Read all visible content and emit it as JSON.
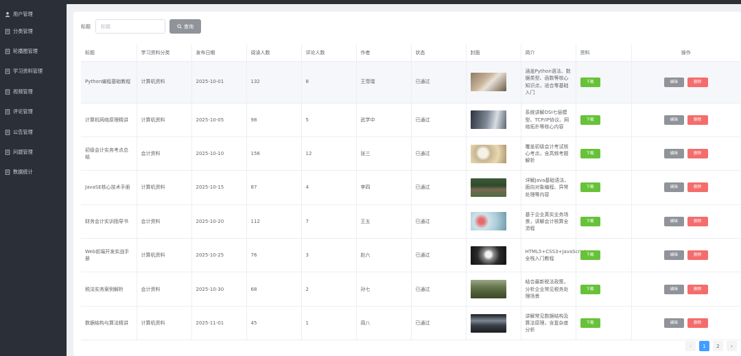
{
  "sidebar": {
    "items": [
      {
        "label": "用户管理",
        "icon": "user-icon"
      },
      {
        "label": "分类管理",
        "icon": "document-icon"
      },
      {
        "label": "轮播图管理",
        "icon": "document-icon"
      },
      {
        "label": "学习资料管理",
        "icon": "document-icon"
      },
      {
        "label": "视频管理",
        "icon": "document-icon"
      },
      {
        "label": "评论管理",
        "icon": "document-icon"
      },
      {
        "label": "公告管理",
        "icon": "document-icon"
      },
      {
        "label": "问题管理",
        "icon": "document-icon"
      },
      {
        "label": "数据统计",
        "icon": "document-icon"
      }
    ]
  },
  "search": {
    "label": "标题",
    "placeholder": "标题",
    "button_label": "查询"
  },
  "table": {
    "columns": [
      "标题",
      "学习资料分类",
      "发布日期",
      "阅读人数",
      "评论人数",
      "作者",
      "状态",
      "封面",
      "简介",
      "资料",
      "操作"
    ],
    "download_label": "下载",
    "edit_label": "编辑",
    "delete_label": "删除",
    "rows": [
      {
        "title": "Python编程基础教程",
        "category": "计算机资料",
        "date": "2025-10-01",
        "reads": "132",
        "comments": "8",
        "author": "王雪瑞",
        "status": "已通过",
        "cover": "laptop-desk-photo",
        "intro": "涵盖Python语法、数据类型、函数等核心知识点，适合零基础入门"
      },
      {
        "title": "计算机网络原理精讲",
        "category": "计算机资料",
        "date": "2025-10-05",
        "reads": "98",
        "comments": "5",
        "author": "武学中",
        "status": "已通过",
        "cover": "device-closeup-photo",
        "intro": "系统讲解OSI七层模型、TCP/IP协议、网络拓扑等核心内容"
      },
      {
        "title": "初级会计实务考点总结",
        "category": "会计资料",
        "date": "2025-10-10",
        "reads": "156",
        "comments": "12",
        "author": "张三",
        "status": "已通过",
        "cover": "dandelion-photo",
        "intro": "覆盖初级会计考试核心考点，含高频考题解析"
      },
      {
        "title": "JavaSE核心技术手册",
        "category": "计算机资料",
        "date": "2025-10-15",
        "reads": "87",
        "comments": "4",
        "author": "李四",
        "status": "已通过",
        "cover": "grass-field-photo",
        "intro": "详解Java基础语法、面向对象编程、异常处理等内容"
      },
      {
        "title": "财务会计实训指导书",
        "category": "会计资料",
        "date": "2025-10-20",
        "reads": "112",
        "comments": "7",
        "author": "王五",
        "status": "已通过",
        "cover": "blossom-photo",
        "intro": "基于企业真实业务场景，讲解会计核算全流程"
      },
      {
        "title": "Web前端开发实战手册",
        "category": "计算机资料",
        "date": "2025-10-25",
        "reads": "76",
        "comments": "3",
        "author": "赵六",
        "status": "已通过",
        "cover": "dandelion-dark-photo",
        "intro": "HTML5+CSS3+JavaScript全栈入门教程"
      },
      {
        "title": "税法实务案例解析",
        "category": "会计资料",
        "date": "2025-10-30",
        "reads": "68",
        "comments": "2",
        "author": "孙七",
        "status": "已通过",
        "cover": "wheat-field-photo",
        "intro": "结合最新税法政策，分析企业常见税务处理场景"
      },
      {
        "title": "数据结构与算法精讲",
        "category": "计算机资料",
        "date": "2025-11-01",
        "reads": "45",
        "comments": "1",
        "author": "周八",
        "status": "已通过",
        "cover": "road-landscape-photo",
        "intro": "讲解常见数据结构及算法原理，含复杂度分析"
      }
    ]
  },
  "pagination": {
    "prev": "‹",
    "pages": [
      "1",
      "2"
    ],
    "next": "›",
    "current": "1"
  },
  "colors": {
    "sidebar_bg": "#2a2f38",
    "download": "#67c23a",
    "edit": "#909399",
    "delete": "#f56c6c",
    "active_page": "#409eff"
  }
}
